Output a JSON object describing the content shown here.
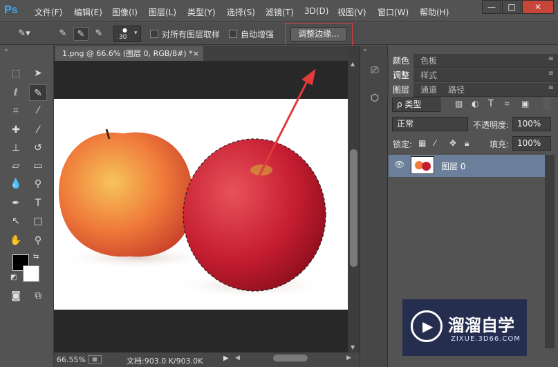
{
  "app": {
    "logo": "Ps"
  },
  "menu": [
    "文件(F)",
    "编辑(E)",
    "图像(I)",
    "图层(L)",
    "类型(Y)",
    "选择(S)",
    "滤镜(T)",
    "3D(D)",
    "视图(V)",
    "窗口(W)",
    "帮助(H)"
  ],
  "window_controls": {
    "minimize": "—",
    "maximize": "□",
    "close": "✕"
  },
  "options": {
    "brush_size": "30",
    "sample_all_layers": "对所有图层取样",
    "auto_enhance": "自动增强",
    "refine_edge": "调整边缘..."
  },
  "document": {
    "tab_title": "1.png @ 66.6% (图层 0, RGB/8#) *",
    "tab_close": "×",
    "zoom": "66.55%",
    "doc_size": "文档:903.0 K/903.0K"
  },
  "panels": {
    "row1": [
      "颜色",
      "色板"
    ],
    "row2": [
      "调整",
      "样式"
    ],
    "row3": [
      "图层",
      "通道",
      "路径"
    ],
    "filter_kind": "ρ 类型",
    "blend_mode": "正常",
    "opacity_label": "不透明度:",
    "opacity_value": "100%",
    "lock_label": "锁定:",
    "fill_label": "填充:",
    "fill_value": "100%",
    "layer_name": "图层 0"
  },
  "watermark": {
    "brand": "溜溜自学",
    "url": "ZIXUE.3D66.COM"
  },
  "colors": {
    "ps_blue": "#3ea8f5",
    "highlight_red": "#e23b3b",
    "layer_selected": "#6b7f9a"
  }
}
